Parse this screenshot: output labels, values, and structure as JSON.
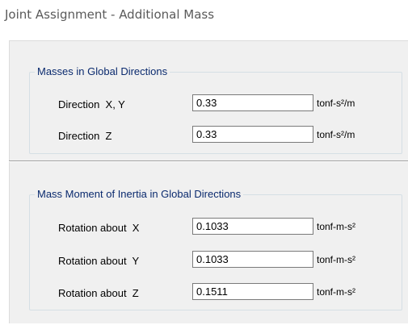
{
  "window": {
    "title": "Joint Assignment - Additional Mass"
  },
  "masses": {
    "legend": "Masses in Global Directions",
    "rows": [
      {
        "label": "Direction  X, Y",
        "value": "0.33",
        "unit": "tonf-s²/m"
      },
      {
        "label": "Direction  Z",
        "value": "0.33",
        "unit": "tonf-s²/m"
      }
    ]
  },
  "inertia": {
    "legend": "Mass Moment of Inertia in Global Directions",
    "rows": [
      {
        "label": "Rotation about  X",
        "value": "0.1033",
        "unit": "tonf-m-s²"
      },
      {
        "label": "Rotation about  Y",
        "value": "0.1033",
        "unit": "tonf-m-s²"
      },
      {
        "label": "Rotation about  Z",
        "value": "0.1511",
        "unit": "tonf-m-s²"
      }
    ]
  },
  "colors": {
    "legend_text": "#0a2a6e",
    "panel_bg": "#f0f0f0",
    "title_text": "#5a5a5a"
  }
}
